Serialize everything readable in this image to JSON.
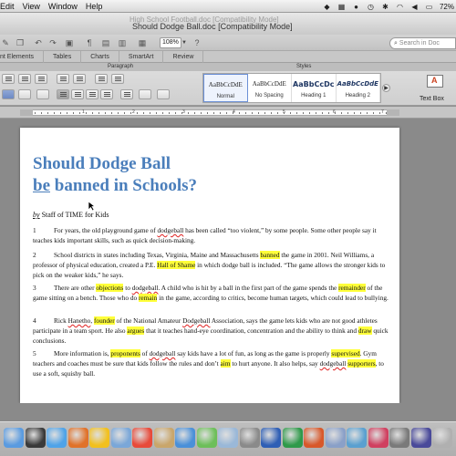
{
  "menubar": {
    "items": [
      "Edit",
      "View",
      "Window",
      "Help"
    ],
    "battery": "72%"
  },
  "window": {
    "ghost_title": "High School Football.doc [Compatibility Mode]",
    "title": "Should Dodge Ball.doc [Compatibility Mode]"
  },
  "toolbar": {
    "zoom": "108%",
    "search_placeholder": "Search in Doc"
  },
  "ribbon": {
    "tabs": [
      "nt Elements",
      "Tables",
      "Charts",
      "SmartArt",
      "Review"
    ],
    "groups": {
      "paragraph": "Paragraph",
      "styles": "Styles"
    },
    "styles": [
      {
        "sample": "AaBbCcDdE",
        "name": "Normal"
      },
      {
        "sample": "AaBbCcDdE",
        "name": "No Spacing"
      },
      {
        "sample": "AaBbCcDc",
        "name": "Heading 1"
      },
      {
        "sample": "AaBbCcDdE",
        "name": "Heading 2"
      }
    ],
    "text_box_label": "Text Box"
  },
  "ruler": {
    "numbers": [
      "1",
      "2",
      "3",
      "4",
      "5",
      "6",
      "7"
    ]
  },
  "document": {
    "title_line1": "Should Dodge Ball",
    "title_be": "be",
    "title_line2_rest": " banned in Schools?",
    "byline_by": "by",
    "byline_rest": " Staff of TIME for Kids",
    "paragraphs": [
      {
        "num": "1",
        "parts": [
          {
            "t": "For years, the old playground game of "
          },
          {
            "t": "dodgeball",
            "sq": true
          },
          {
            "t": " has been called “too violent,” by some people. Some other people say it teaches kids important skills, such as quick decision-making."
          }
        ]
      },
      {
        "num": "2",
        "parts": [
          {
            "t": "School districts in states including Texas, Virginia, Maine and Massachusetts "
          },
          {
            "t": "banned",
            "hl": true
          },
          {
            "t": " the game in 2001. Neil Williams, a professor of physical education, created a P.E. "
          },
          {
            "t": "Hall of Shame",
            "hl": true
          },
          {
            "t": " in which dodge ball is included. “The game allows the stronger kids to pick on the weaker kids,” he says."
          }
        ]
      },
      {
        "num": "3",
        "parts": [
          {
            "t": "There are other "
          },
          {
            "t": "objections",
            "hl": true
          },
          {
            "t": " to "
          },
          {
            "t": "dodgeball",
            "sq": true
          },
          {
            "t": ". A child who is hit by a ball in the first part of the game spends the "
          },
          {
            "t": "remainder",
            "hl": true
          },
          {
            "t": " of the game sitting on a bench. Those who do "
          },
          {
            "t": "remain",
            "hl": true
          },
          {
            "t": " in the game, according to critics, become human targets, which could lead to bullying."
          }
        ]
      },
      {
        "num": "4",
        "parts": [
          {
            "t": "Rick "
          },
          {
            "t": "Hanetho",
            "sq": true
          },
          {
            "t": ", "
          },
          {
            "t": "founder",
            "hl": true
          },
          {
            "t": " of the National Amateur "
          },
          {
            "t": "Dodgeball",
            "sq": true
          },
          {
            "t": " Association, says the game lets kids who are not good athletes participate in a team sport. He also "
          },
          {
            "t": "argues",
            "hl": true
          },
          {
            "t": " that it teaches hand-eye coordination, concentration and the ability to think and "
          },
          {
            "t": "draw",
            "hl": true
          },
          {
            "t": " quick conclusions."
          }
        ]
      },
      {
        "num": "5",
        "parts": [
          {
            "t": "More information is, "
          },
          {
            "t": "proponents",
            "hl": true
          },
          {
            "t": " of "
          },
          {
            "t": "dodgeball",
            "sq": true
          },
          {
            "t": " say kids have a lot of fun, as long as the game is properly "
          },
          {
            "t": "supervised",
            "hl": true
          },
          {
            "t": ". Gym teachers and coaches must be sure that kids follow the rules and don’t "
          },
          {
            "t": "aim",
            "hl": true
          },
          {
            "t": " to hurt anyone. It also helps, say "
          },
          {
            "t": "dodgeball",
            "sq": true
          },
          {
            "t": " "
          },
          {
            "t": "supporters",
            "hl": true
          },
          {
            "t": ", to use a soft, squishy ball."
          }
        ]
      }
    ]
  },
  "colors": {
    "heading": "#4a7ebb",
    "highlight": "#ffff3a",
    "spelling_squiggle": "#e02020"
  },
  "dock": {
    "icons": [
      "finder-icon",
      "dashboard-icon",
      "safari-icon",
      "firefox-icon",
      "chrome-icon",
      "mail-icon",
      "ical-icon",
      "addressbook-icon",
      "itunes-icon",
      "iphoto-icon",
      "preview-icon",
      "system-preferences-icon",
      "word-icon",
      "excel-icon",
      "powerpoint-icon",
      "network-icon",
      "app-icon",
      "app-icon",
      "app-icon",
      "app-icon",
      "trash-icon"
    ]
  }
}
